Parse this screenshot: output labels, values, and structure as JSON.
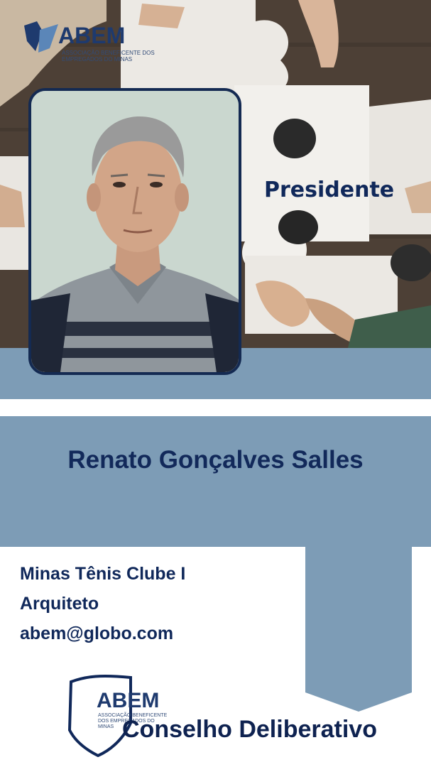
{
  "header": {
    "logo_text": "ABEM",
    "logo_subtitle": "ASSOCIAÇÃO BENEFICENTE DOS EMPREGADOS DO MINAS"
  },
  "role": "Presidente",
  "member": {
    "name": "Renato Gonçalves Salles",
    "club": "Minas Tênis Clube I",
    "profession": "Arquiteto",
    "email": "abem@globo.com"
  },
  "footer": {
    "logo_text": "ABEM",
    "logo_subtitle": "ASSOCIAÇÃO BENEFICENTE DOS EMPREGADOS DO MINAS",
    "council": "Conselho Deliberativo"
  },
  "colors": {
    "navy": "#10285a",
    "band": "#7d9cb6",
    "white": "#ffffff"
  },
  "icons": [
    "abem-logo-icon",
    "puzzle-background",
    "portrait-photo"
  ]
}
